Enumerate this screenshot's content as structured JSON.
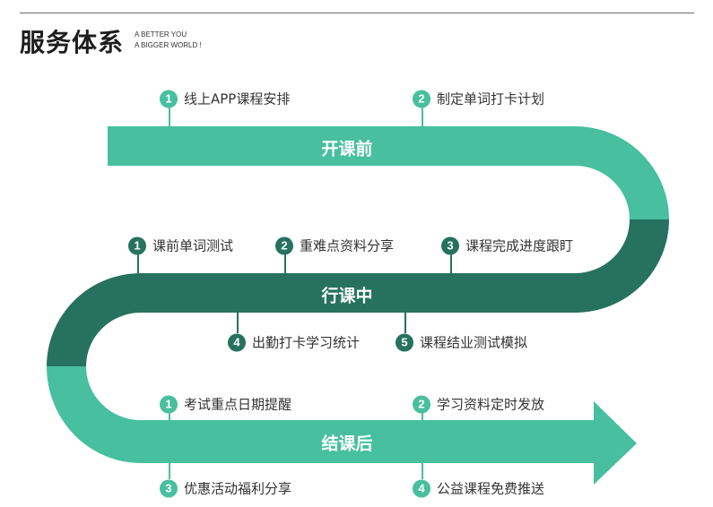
{
  "header": {
    "title": "服务体系",
    "tagline_line1": "A BETTER YOU",
    "tagline_line2": "A BIGGER WORLD !"
  },
  "colors": {
    "light": "#48bf9f",
    "dark": "#26725f",
    "text": "#333333"
  },
  "stages": [
    {
      "label": "开课前",
      "items": [
        {
          "num": "1",
          "text": "线上APP课程安排"
        },
        {
          "num": "2",
          "text": "制定单词打卡计划"
        }
      ]
    },
    {
      "label": "行课中",
      "items": [
        {
          "num": "1",
          "text": "课前单词测试"
        },
        {
          "num": "2",
          "text": "重难点资料分享"
        },
        {
          "num": "3",
          "text": "课程完成进度跟盯"
        },
        {
          "num": "4",
          "text": "出勤打卡学习统计"
        },
        {
          "num": "5",
          "text": "课程结业测试模拟"
        }
      ]
    },
    {
      "label": "结课后",
      "items": [
        {
          "num": "1",
          "text": "考试重点日期提醒"
        },
        {
          "num": "2",
          "text": "学习资料定时发放"
        },
        {
          "num": "3",
          "text": "优惠活动福利分享"
        },
        {
          "num": "4",
          "text": "公益课程免费推送"
        }
      ]
    }
  ]
}
